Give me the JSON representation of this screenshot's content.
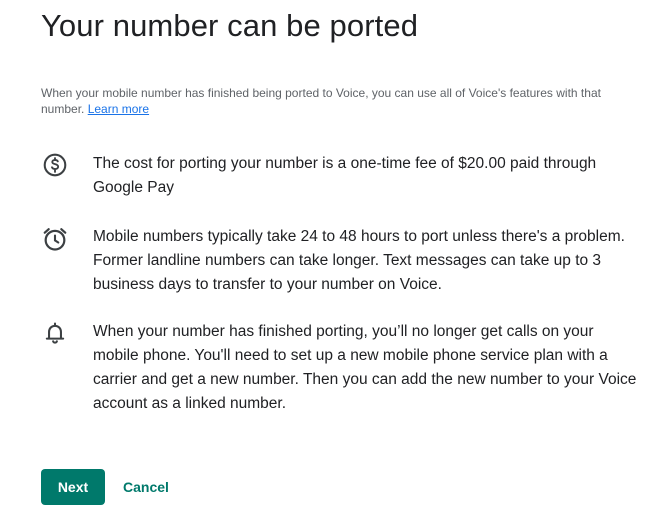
{
  "header": {
    "title": "Your number can be ported"
  },
  "intro": {
    "text": "When your mobile number has finished being ported to Voice, you can use all of Voice's features with that number.",
    "link_label": "Learn more"
  },
  "items": [
    {
      "icon": "dollar-circle-icon",
      "text": "The cost for porting your number is a one-time fee of $20.00 paid through Google Pay"
    },
    {
      "icon": "alarm-clock-icon",
      "text": "Mobile numbers typically take 24 to 48 hours to port unless there's a problem. Former landline numbers can take longer. Text messages can take up to 3 business days to transfer to your number on Voice."
    },
    {
      "icon": "bell-icon",
      "text": "When your number has finished porting, you’ll no longer get calls on your mobile phone. You'll need to set up a new mobile phone service plan with a carrier and get a new number. Then you can add the new number to your Voice account as a linked number."
    }
  ],
  "actions": {
    "next_label": "Next",
    "cancel_label": "Cancel"
  },
  "colors": {
    "accent": "#00796b",
    "link": "#1a73e8",
    "text": "#202124",
    "secondary_text": "#5f6368"
  }
}
